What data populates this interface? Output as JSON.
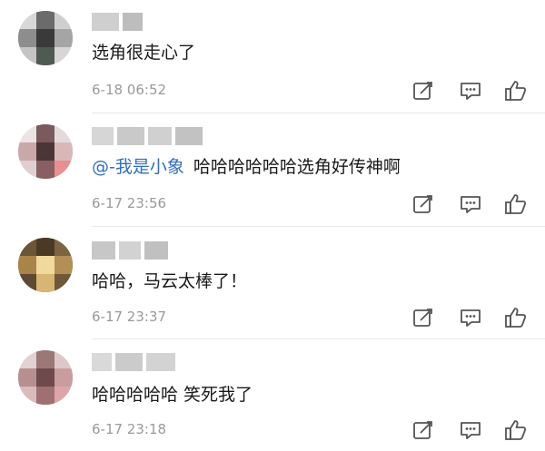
{
  "comments": [
    {
      "text": "选角很走心了",
      "mention": "",
      "time": "6-18 06:52"
    },
    {
      "text": "哈哈哈哈哈哈选角好传神啊",
      "mention": "@-我是小象",
      "time": "6-17 23:56"
    },
    {
      "text": "哈哈，马云太棒了！",
      "mention": "",
      "time": "6-17 23:37"
    },
    {
      "text": "哈哈哈哈哈 笑死我了",
      "mention": "",
      "time": "6-17 23:18"
    }
  ],
  "icons": [
    "edit-icon",
    "comment-icon",
    "like-icon"
  ],
  "colors": {
    "mention": "#2f6fbd",
    "time": "#9a9a9a",
    "text": "#1a1a1a",
    "icon": "#555555"
  }
}
